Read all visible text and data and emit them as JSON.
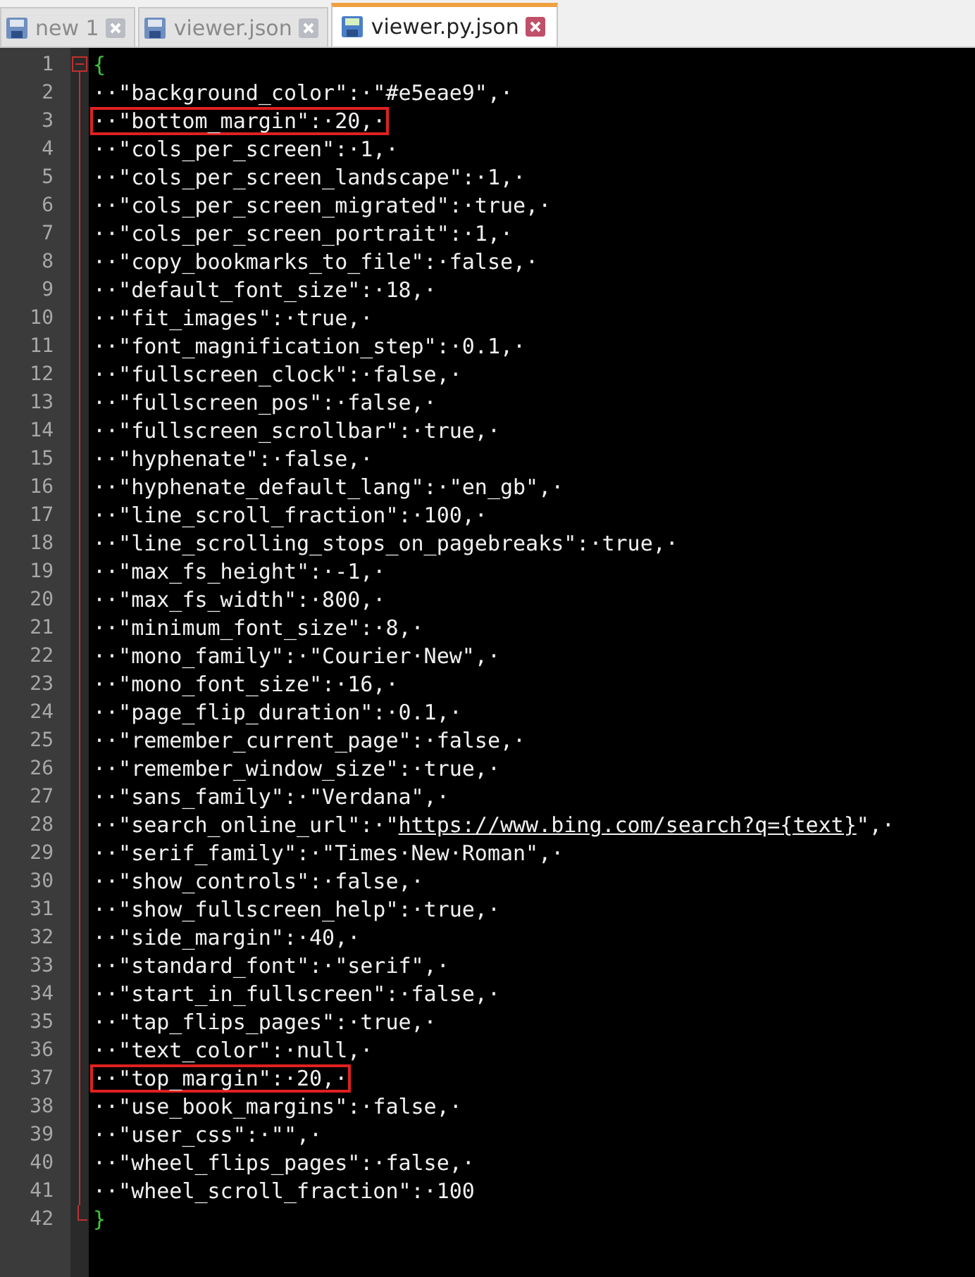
{
  "tabs": [
    {
      "label": "new 1",
      "selected": false
    },
    {
      "label": "viewer.json",
      "selected": false
    },
    {
      "label": "viewer.py.json",
      "selected": true
    }
  ],
  "lines": [
    {
      "number": "1",
      "kind": "open-brace",
      "text": "{",
      "boxed": false
    },
    {
      "number": "2",
      "kind": "entry",
      "text": "··\"background_color\":·\"#e5eae9\",·",
      "boxed": false
    },
    {
      "number": "3",
      "kind": "entry",
      "text": "··\"bottom_margin\":·20,·",
      "boxed": true
    },
    {
      "number": "4",
      "kind": "entry",
      "text": "··\"cols_per_screen\":·1,·",
      "boxed": false
    },
    {
      "number": "5",
      "kind": "entry",
      "text": "··\"cols_per_screen_landscape\":·1,·",
      "boxed": false
    },
    {
      "number": "6",
      "kind": "entry",
      "text": "··\"cols_per_screen_migrated\":·true,·",
      "boxed": false
    },
    {
      "number": "7",
      "kind": "entry",
      "text": "··\"cols_per_screen_portrait\":·1,·",
      "boxed": false
    },
    {
      "number": "8",
      "kind": "entry",
      "text": "··\"copy_bookmarks_to_file\":·false,·",
      "boxed": false
    },
    {
      "number": "9",
      "kind": "entry",
      "text": "··\"default_font_size\":·18,·",
      "boxed": false
    },
    {
      "number": "10",
      "kind": "entry",
      "text": "··\"fit_images\":·true,·",
      "boxed": false
    },
    {
      "number": "11",
      "kind": "entry",
      "text": "··\"font_magnification_step\":·0.1,·",
      "boxed": false
    },
    {
      "number": "12",
      "kind": "entry",
      "text": "··\"fullscreen_clock\":·false,·",
      "boxed": false
    },
    {
      "number": "13",
      "kind": "entry",
      "text": "··\"fullscreen_pos\":·false,·",
      "boxed": false
    },
    {
      "number": "14",
      "kind": "entry",
      "text": "··\"fullscreen_scrollbar\":·true,·",
      "boxed": false
    },
    {
      "number": "15",
      "kind": "entry",
      "text": "··\"hyphenate\":·false,·",
      "boxed": false
    },
    {
      "number": "16",
      "kind": "entry",
      "text": "··\"hyphenate_default_lang\":·\"en_gb\",·",
      "boxed": false
    },
    {
      "number": "17",
      "kind": "entry",
      "text": "··\"line_scroll_fraction\":·100,·",
      "boxed": false
    },
    {
      "number": "18",
      "kind": "entry",
      "text": "··\"line_scrolling_stops_on_pagebreaks\":·true,·",
      "boxed": false
    },
    {
      "number": "19",
      "kind": "entry",
      "text": "··\"max_fs_height\":·-1,·",
      "boxed": false
    },
    {
      "number": "20",
      "kind": "entry",
      "text": "··\"max_fs_width\":·800,·",
      "boxed": false
    },
    {
      "number": "21",
      "kind": "entry",
      "text": "··\"minimum_font_size\":·8,·",
      "boxed": false
    },
    {
      "number": "22",
      "kind": "entry",
      "text": "··\"mono_family\":·\"Courier·New\",·",
      "boxed": false
    },
    {
      "number": "23",
      "kind": "entry",
      "text": "··\"mono_font_size\":·16,·",
      "boxed": false
    },
    {
      "number": "24",
      "kind": "entry",
      "text": "··\"page_flip_duration\":·0.1,·",
      "boxed": false
    },
    {
      "number": "25",
      "kind": "entry",
      "text": "··\"remember_current_page\":·false,·",
      "boxed": false
    },
    {
      "number": "26",
      "kind": "entry",
      "text": "··\"remember_window_size\":·true,·",
      "boxed": false
    },
    {
      "number": "27",
      "kind": "entry",
      "text": "··\"sans_family\":·\"Verdana\",·",
      "boxed": false
    },
    {
      "number": "28",
      "kind": "entry",
      "text": "··\"search_online_url\":·\"",
      "link": "https://www.bing.com/search?q={text}",
      "tail": "\",·",
      "boxed": false
    },
    {
      "number": "29",
      "kind": "entry",
      "text": "··\"serif_family\":·\"Times·New·Roman\",·",
      "boxed": false
    },
    {
      "number": "30",
      "kind": "entry",
      "text": "··\"show_controls\":·false,·",
      "boxed": false
    },
    {
      "number": "31",
      "kind": "entry",
      "text": "··\"show_fullscreen_help\":·true,·",
      "boxed": false
    },
    {
      "number": "32",
      "kind": "entry",
      "text": "··\"side_margin\":·40,·",
      "boxed": false
    },
    {
      "number": "33",
      "kind": "entry",
      "text": "··\"standard_font\":·\"serif\",·",
      "boxed": false
    },
    {
      "number": "34",
      "kind": "entry",
      "text": "··\"start_in_fullscreen\":·false,·",
      "boxed": false
    },
    {
      "number": "35",
      "kind": "entry",
      "text": "··\"tap_flips_pages\":·true,·",
      "boxed": false
    },
    {
      "number": "36",
      "kind": "entry",
      "text": "··\"text_color\":·null,·",
      "boxed": false
    },
    {
      "number": "37",
      "kind": "entry",
      "text": "··\"top_margin\":·20,·",
      "boxed": true
    },
    {
      "number": "38",
      "kind": "entry",
      "text": "··\"use_book_margins\":·false,·",
      "boxed": false
    },
    {
      "number": "39",
      "kind": "entry",
      "text": "··\"user_css\":·\"\",·",
      "boxed": false
    },
    {
      "number": "40",
      "kind": "entry",
      "text": "··\"wheel_flips_pages\":·false,·",
      "boxed": false
    },
    {
      "number": "41",
      "kind": "entry",
      "text": "··\"wheel_scroll_fraction\":·100",
      "boxed": false
    },
    {
      "number": "42",
      "kind": "close-brace",
      "text": "}",
      "boxed": false
    }
  ]
}
